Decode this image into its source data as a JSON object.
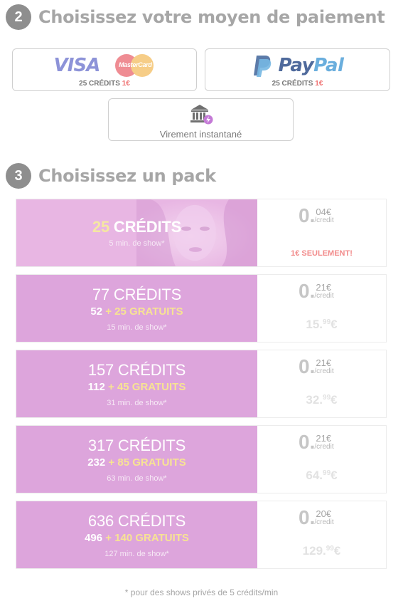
{
  "step2": {
    "number": "2",
    "title": "Choisissez votre moyen de paiement"
  },
  "payment": {
    "card": {
      "visa_label": "VISA",
      "mastercard_label": "MasterCard",
      "credits": "25 CRÉDITS",
      "price": "1€"
    },
    "paypal": {
      "label_pay": "Pay",
      "label_pal": "Pal",
      "credits": "25 CRÉDITS",
      "price": "1€"
    },
    "virement": {
      "label": "Virement instantané"
    }
  },
  "step3": {
    "number": "3",
    "title": "Choisissez un pack"
  },
  "packs": [
    {
      "credits_num": "25",
      "credits_word": "CRÉDITS",
      "duration": "5 min. de show*",
      "rate_int": "0",
      "rate_dec": "04€",
      "rate_unit": "/credit",
      "note": "1€ SEULEMENT!"
    },
    {
      "credits_full": "77 CRÉDITS",
      "bonus_base": "52",
      "bonus_gratuits": "+ 25 GRATUITS",
      "duration": "15 min. de show*",
      "rate_int": "0",
      "rate_dec": "21€",
      "rate_unit": "/credit",
      "price_main": "15.",
      "price_cents": "99",
      "price_cur": "€"
    },
    {
      "credits_full": "157 CRÉDITS",
      "bonus_base": "112",
      "bonus_gratuits": "+ 45 GRATUITS",
      "duration": "31 min. de show*",
      "rate_int": "0",
      "rate_dec": "21€",
      "rate_unit": "/credit",
      "price_main": "32.",
      "price_cents": "99",
      "price_cur": "€"
    },
    {
      "credits_full": "317 CRÉDITS",
      "bonus_base": "232",
      "bonus_gratuits": "+ 85 GRATUITS",
      "duration": "63 min. de show*",
      "rate_int": "0",
      "rate_dec": "21€",
      "rate_unit": "/credit",
      "price_main": "64.",
      "price_cents": "99",
      "price_cur": "€"
    },
    {
      "credits_full": "636 CRÉDITS",
      "bonus_base": "496",
      "bonus_gratuits": "+ 140 GRATUITS",
      "duration": "127 min. de show*",
      "rate_int": "0",
      "rate_dec": "20€",
      "rate_unit": "/credit",
      "price_main": "129.",
      "price_cents": "99",
      "price_cur": "€"
    }
  ],
  "footnote": "* pour des shows privés de 5 crédits/min",
  "icons": {
    "bank": "bank-icon",
    "lightning": "lightning-badge-icon",
    "paypal": "paypal-logo-icon",
    "mastercard": "mastercard-logo-icon"
  },
  "colors": {
    "pack_bg": "#dda5dc",
    "gratuits": "#f7e393",
    "accent_red": "#ef7070",
    "step_circle": "#8e8e8e"
  }
}
